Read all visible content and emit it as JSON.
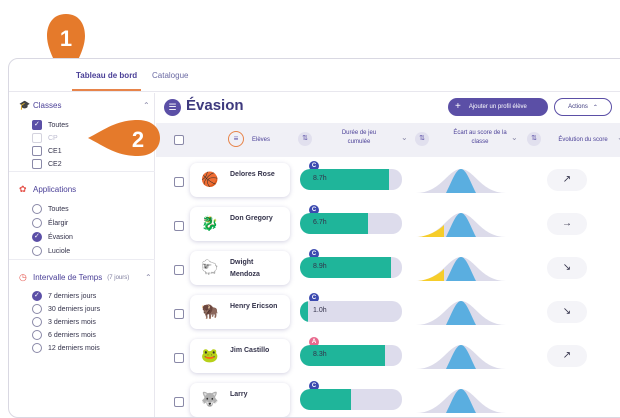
{
  "tabs": {
    "active": "Tableau de bord",
    "inactive": "Catalogue"
  },
  "sidebar": {
    "classes": {
      "title": "Classes",
      "items": [
        {
          "label": "Toutes",
          "state": "on"
        },
        {
          "label": "CP",
          "state": "dim"
        },
        {
          "label": "CE1",
          "state": "off"
        },
        {
          "label": "CE2",
          "state": "off"
        }
      ]
    },
    "applications": {
      "title": "Applications",
      "items": [
        {
          "label": "Toutes",
          "state": "off"
        },
        {
          "label": "Élargir",
          "state": "off"
        },
        {
          "label": "Évasion",
          "state": "on"
        },
        {
          "label": "Luciole",
          "state": "off"
        }
      ]
    },
    "interval": {
      "title": "Intervalle de Temps",
      "sub": "(7 jours)",
      "items": [
        {
          "label": "7 derniers jours",
          "state": "on"
        },
        {
          "label": "30 derniers jours",
          "state": "off"
        },
        {
          "label": "3 derniers mois",
          "state": "off"
        },
        {
          "label": "6 derniers mois",
          "state": "off"
        },
        {
          "label": "12 derniers mois",
          "state": "off"
        }
      ]
    }
  },
  "main": {
    "title": "Évasion",
    "add_label": "Ajouter un profil élève",
    "actions_label": "Actions",
    "headers": {
      "eleves": "Elèves",
      "duree": "Durée de jeu\ncumulée",
      "ecart": "Écart au score de la\nclasse",
      "evolution": "Évolution du score"
    },
    "rows": [
      {
        "name": "Delores Rose",
        "badge": "C",
        "badge_color": "#3d4bb0",
        "avatar": "🏀",
        "time": "8.7h",
        "progress": 0.87,
        "arrow": "↗",
        "dist": "center"
      },
      {
        "name": "Don Gregory",
        "badge": "C",
        "badge_color": "#3d4bb0",
        "avatar": "🐉",
        "time": "6.7h",
        "progress": 0.67,
        "arrow": "→",
        "dist": "low"
      },
      {
        "name": "Dwight Mendoza",
        "badge": "C",
        "badge_color": "#3d4bb0",
        "avatar": "🐑",
        "time": "8.9h",
        "progress": 0.89,
        "arrow": "↘",
        "dist": "low"
      },
      {
        "name": "Henry Ericson",
        "badge": "C",
        "badge_color": "#3d4bb0",
        "avatar": "🦬",
        "time": "1.0h",
        "progress": 0.08,
        "arrow": "↘",
        "dist": "center"
      },
      {
        "name": "Jim Castillo",
        "badge": "A",
        "badge_color": "#e86a8e",
        "avatar": "🐸",
        "time": "8.3h",
        "progress": 0.83,
        "arrow": "↗",
        "dist": "center"
      },
      {
        "name": "Larry",
        "badge": "C",
        "badge_color": "#3d4bb0",
        "avatar": "🐺",
        "time": "",
        "progress": 0.5,
        "arrow": "",
        "dist": "center"
      }
    ]
  },
  "markers": {
    "one": "1",
    "two": "2",
    "color": "#e57a2b"
  }
}
